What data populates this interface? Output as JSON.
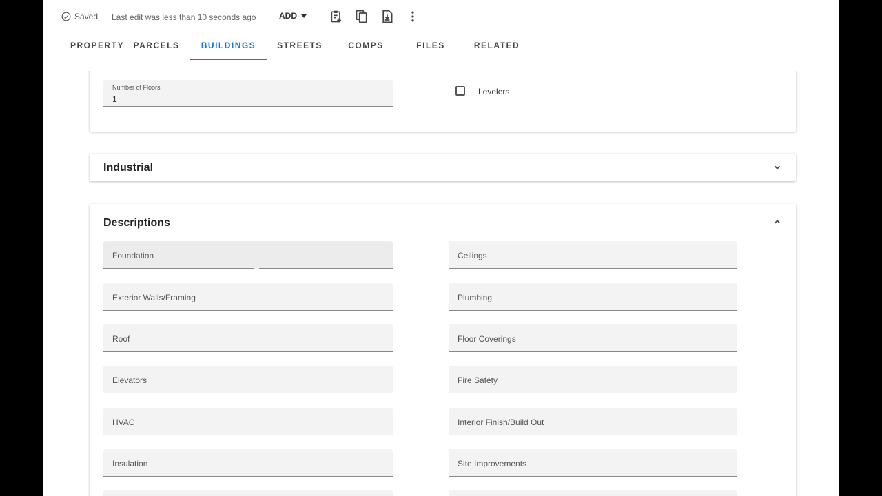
{
  "toolbar": {
    "saved_label": "Saved",
    "last_edit": "Last edit was less than 10 seconds ago",
    "add_label": "ADD",
    "icons": [
      "clipboard-add-icon",
      "copy-icon",
      "file-download-icon",
      "more-vert-icon"
    ]
  },
  "tabs": [
    "PROPERTY",
    "PARCELS",
    "BUILDINGS",
    "STREETS",
    "COMPS",
    "FILES",
    "RELATED"
  ],
  "active_tab": "BUILDINGS",
  "general": {
    "floors_label": "Number of Floors",
    "floors_value": "1",
    "levelers_label": "Levelers"
  },
  "industrial": {
    "title": "Industrial"
  },
  "descriptions": {
    "title": "Descriptions",
    "left": [
      "Foundation",
      "Exterior Walls/Framing",
      "Roof",
      "Elevators",
      "HVAC",
      "Insulation"
    ],
    "right": [
      "Ceilings",
      "Plumbing",
      "Floor Coverings",
      "Fire Safety",
      "Interior Finish/Build Out",
      "Site Improvements"
    ]
  },
  "colors": {
    "accent": "#1976d2",
    "field_bg": "#f3f3f3"
  }
}
